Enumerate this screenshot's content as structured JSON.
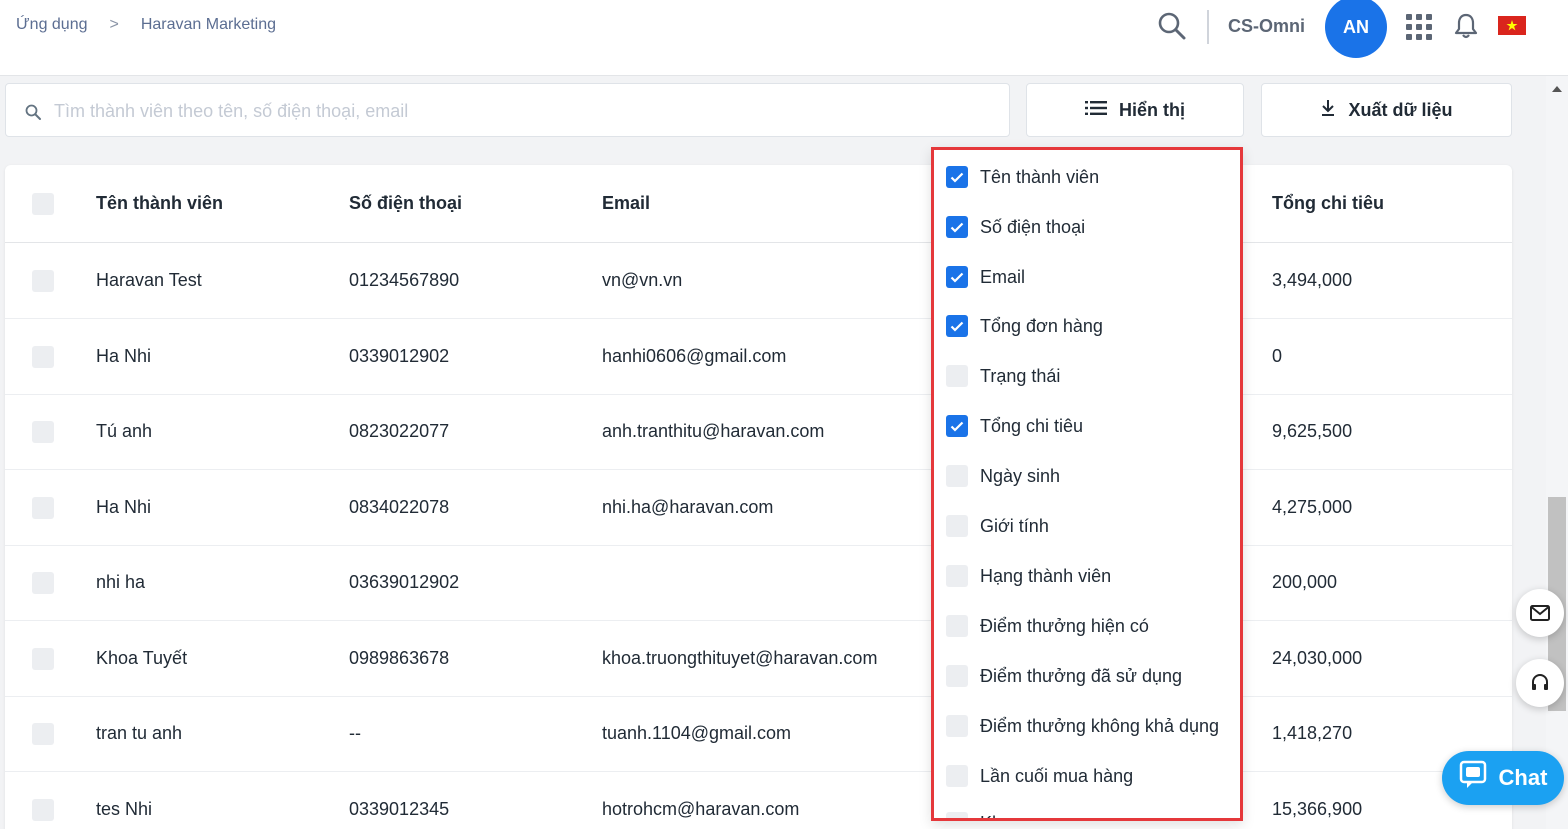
{
  "breadcrumb": {
    "item1": "Ứng dụng",
    "sep": ">",
    "item2": "Haravan Marketing"
  },
  "header": {
    "store_name": "CS-Omni",
    "avatar_initials": "AN"
  },
  "search": {
    "placeholder": "Tìm thành viên theo tên, số điện thoại, email"
  },
  "toolbar": {
    "display_label": "Hiển thị",
    "export_label": "Xuất dữ liệu"
  },
  "table": {
    "headers": {
      "name": "Tên thành viên",
      "phone": "Số điện thoại",
      "email": "Email",
      "total": "Tổng chi tiêu"
    },
    "rows": [
      {
        "name": "Haravan Test",
        "phone": "01234567890",
        "email": "vn@vn.vn",
        "total": "3,494,000"
      },
      {
        "name": "Ha Nhi",
        "phone": "0339012902",
        "email": "hanhi0606@gmail.com",
        "total": "0"
      },
      {
        "name": "Tú anh",
        "phone": "0823022077",
        "email": "anh.tranthitu@haravan.com",
        "total": "9,625,500"
      },
      {
        "name": "Ha Nhi",
        "phone": "0834022078",
        "email": "nhi.ha@haravan.com",
        "total": "4,275,000"
      },
      {
        "name": "nhi ha",
        "phone": "03639012902",
        "email": "",
        "total": "200,000"
      },
      {
        "name": "Khoa Tuyết",
        "phone": "0989863678",
        "email": "khoa.truongthituyet@haravan.com",
        "total": "24,030,000"
      },
      {
        "name": "tran tu anh",
        "phone": "--",
        "email": "tuanh.1104@gmail.com",
        "total": "1,418,270"
      },
      {
        "name": "tes Nhi",
        "phone": "0339012345",
        "email": "hotrohcm@haravan.com",
        "total": "15,366,900"
      }
    ]
  },
  "columns_menu": [
    {
      "label": "Tên thành viên",
      "checked": true
    },
    {
      "label": "Số điện thoại",
      "checked": true
    },
    {
      "label": "Email",
      "checked": true
    },
    {
      "label": "Tổng đơn hàng",
      "checked": true
    },
    {
      "label": "Trạng thái",
      "checked": false
    },
    {
      "label": "Tổng chi tiêu",
      "checked": true
    },
    {
      "label": "Ngày sinh",
      "checked": false
    },
    {
      "label": "Giới tính",
      "checked": false
    },
    {
      "label": "Hạng thành viên",
      "checked": false
    },
    {
      "label": "Điểm thưởng hiện có",
      "checked": false
    },
    {
      "label": "Điểm thưởng đã sử dụng",
      "checked": false
    },
    {
      "label": "Điểm thưởng không khả dụng",
      "checked": false
    },
    {
      "label": "Lần cuối mua hàng",
      "checked": false
    },
    {
      "label": "Khu vực",
      "checked": false
    }
  ],
  "chat": {
    "label": "Chat"
  },
  "colors": {
    "accent": "#1a73e8",
    "chat": "#1ba1f2",
    "highlight_border": "#e5383b"
  },
  "icons": [
    "search-icon",
    "apps-grid-icon",
    "bell-icon",
    "vietnam-flag-icon",
    "list-icon",
    "download-icon",
    "mail-icon",
    "headset-icon",
    "chat-icon",
    "check-icon"
  ]
}
